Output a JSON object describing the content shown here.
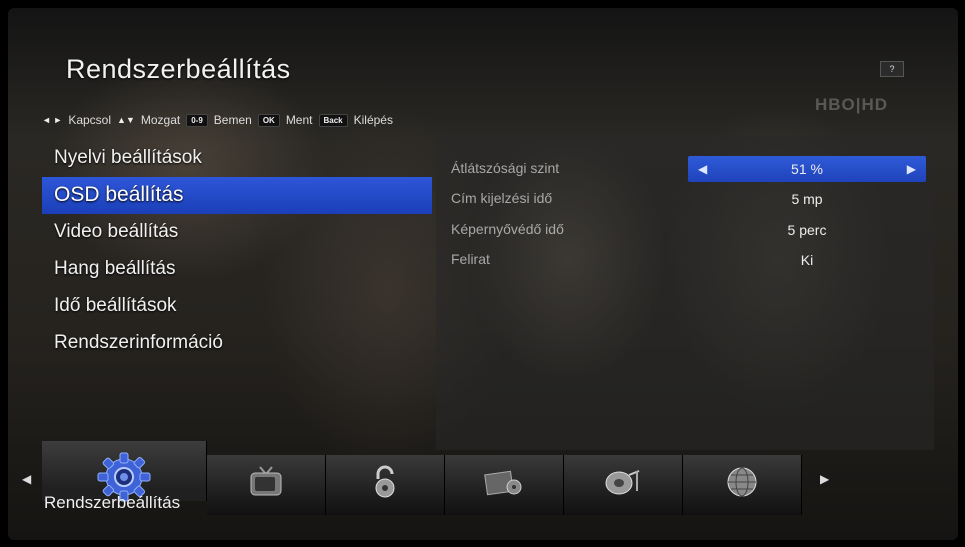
{
  "header": {
    "title": "Rendszerbeállítás",
    "help_label": "?",
    "channel_logo": "HBO|HD"
  },
  "hints": [
    {
      "key": "◄ ►",
      "label": "Kapcsol"
    },
    {
      "key": "▲▼",
      "label": "Mozgat"
    },
    {
      "key": "0-9",
      "label": "Bemen"
    },
    {
      "key": "OK",
      "label": "Ment"
    },
    {
      "key": "Back",
      "label": "Kilépés"
    }
  ],
  "menu": {
    "items": [
      {
        "label": "Nyelvi beállítások"
      },
      {
        "label": "OSD beállítás",
        "selected": true
      },
      {
        "label": "Video beállítás"
      },
      {
        "label": "Hang beállítás"
      },
      {
        "label": "Idő beállítások"
      },
      {
        "label": "Rendszerinformáció"
      }
    ]
  },
  "settings": [
    {
      "label": "Átlátszósági szint",
      "value": "51 %",
      "selected": true
    },
    {
      "label": "Cím kijelzési idő",
      "value": "5 mp"
    },
    {
      "label": "Képernyővédő idő",
      "value": "5 perc"
    },
    {
      "label": "Felirat",
      "value": "Ki"
    }
  ],
  "categories": {
    "selected_label": "Rendszerbeállítás",
    "icons": [
      "gear-icon",
      "tv-icon",
      "padlock-icon",
      "media-icon",
      "satellite-dish-icon",
      "globe-icon"
    ]
  },
  "colors": {
    "highlight": "#2a4fd2"
  }
}
